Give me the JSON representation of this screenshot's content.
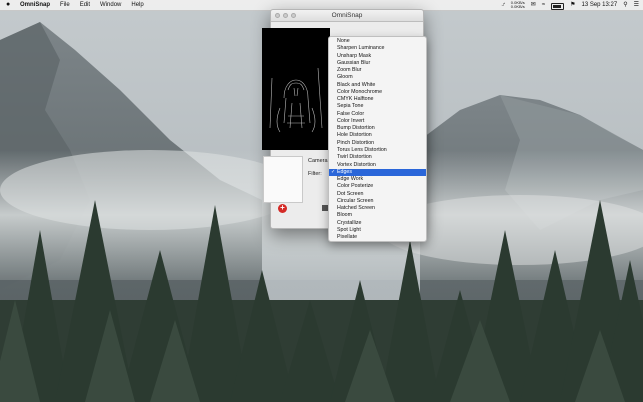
{
  "menubar": {
    "apple": "",
    "app_name": "OmniSnap",
    "menus": [
      "File",
      "Edit",
      "Window",
      "Help"
    ],
    "status": {
      "net_up": "0.0KB/s",
      "net_down": "0.0KB/s",
      "date_time": "13 Sep 13:27"
    }
  },
  "window": {
    "title": "OmniSnap",
    "camera_label": "Camera:",
    "filter_label": "Filter:",
    "add_button": "+"
  },
  "filter_menu": {
    "selected": "Edges",
    "items": [
      "None",
      "Sharpen Luminance",
      "Unsharp Mask",
      "Gaussian Blur",
      "Zoom Blur",
      "Gloom",
      "Black and White",
      "Color Monochrome",
      "CMYK Halftone",
      "Sepia Tone",
      "False Color",
      "Color Invert",
      "Bump Distortion",
      "Hole Distortion",
      "Pinch Distortion",
      "Torus Lens Distortion",
      "Twirl Distortion",
      "Vortex Distortion",
      "Edges",
      "Edge Work",
      "Color Posterize",
      "Dot Screen",
      "Circular Screen",
      "Hatched Screen",
      "Bloom",
      "Crystallize",
      "Spot Light",
      "Pixellate"
    ]
  },
  "colors": {
    "selection": "#2a66d9",
    "add_button": "#d42a26"
  }
}
